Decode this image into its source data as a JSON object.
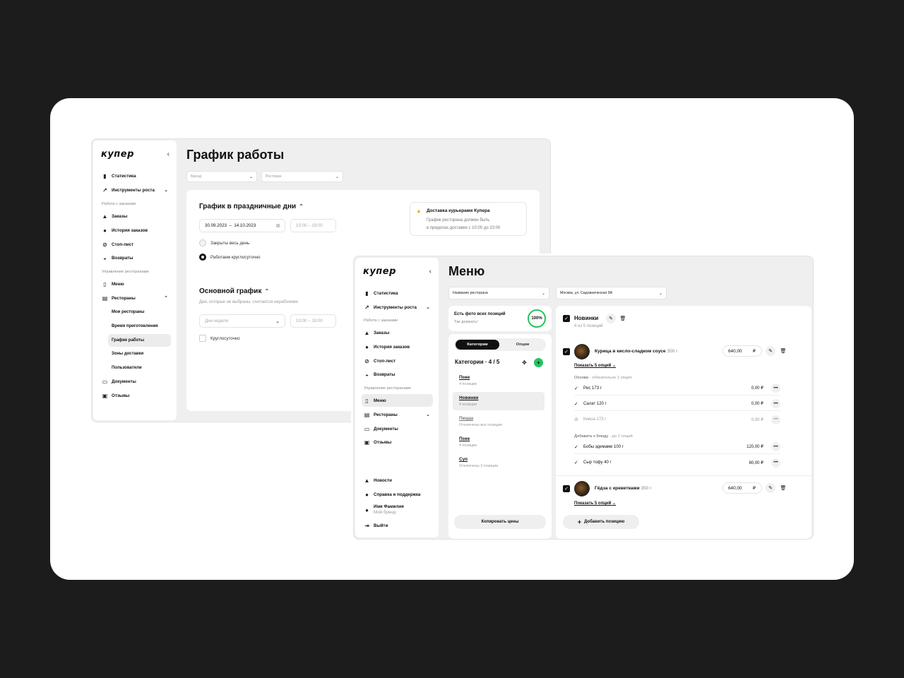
{
  "schedule_window": {
    "logo": "купер",
    "collapse_icon": "‹",
    "nav": [
      {
        "label": "Статистика",
        "icon": "chart-icon"
      },
      {
        "label": "Инструменты роста",
        "icon": "growth-icon"
      },
      {
        "section": "Работа с заказами"
      },
      {
        "label": "Заказы",
        "icon": "orders-icon"
      },
      {
        "label": "История заказов",
        "icon": "history-icon"
      },
      {
        "label": "Стоп-лист",
        "icon": "stop-icon"
      },
      {
        "label": "Возвраты",
        "icon": "returns-icon"
      },
      {
        "section": "Управление ресторанами"
      },
      {
        "label": "Меню",
        "icon": "menu-book-icon"
      },
      {
        "label": "Рестораны",
        "icon": "store-icon"
      }
    ],
    "sections": {
      "orders": "Работа с заказами",
      "restaurants": "Управление ресторанами"
    },
    "items": {
      "stats": "Статистика",
      "growth": "Инструменты роста",
      "orders": "Заказы",
      "history": "История заказов",
      "stoplist": "Стоп-лист",
      "returns": "Возвраты",
      "menu": "Меню",
      "restaurants": "Рестораны",
      "my_restaurants": "Мои рестораны",
      "cook_time": "Время приготовления",
      "schedule": "График работы",
      "zones": "Зоны доставки",
      "users": "Пользователи",
      "documents": "Документы",
      "reviews": "Отзывы"
    },
    "title": "График работы",
    "brand_select": "Бренд",
    "restaurant_select": "Ресторан",
    "holidays": {
      "title": "График в праздничные дни",
      "date_from": "30.09.2023",
      "date_sep": "–",
      "date_to": "14.10.2023",
      "time": "10:00 – 19:00",
      "closed_label": "Закрыты весь день",
      "allday_label": "Работаем круглосуточно"
    },
    "notice": {
      "title": "Доставка курьерами Купера",
      "line1": "График ресторана должен быть",
      "line2": "в пределах доставки с 10:00 до 23:00"
    },
    "main": {
      "title": "Основной график",
      "hint": "Дни, которые не выбраны, считаются нерабочими",
      "days_placeholder": "Дни недели",
      "time": "10:00 – 19:00",
      "allday_label": "Круглосуточно"
    }
  },
  "menu_window": {
    "logo": "купер",
    "items": {
      "stats": "Статистика",
      "growth": "Инструменты роста",
      "orders": "Заказы",
      "history": "История заказов",
      "stoplist": "Стоп-лист",
      "returns": "Возвраты",
      "menu": "Меню",
      "restaurants": "Рестораны",
      "documents": "Документы",
      "reviews": "Отзывы",
      "news": "Новости",
      "help": "Справка и поддержка",
      "user_name": "Имя Фамилия",
      "user_brand": "Мой бренд",
      "logout": "Выйти"
    },
    "sections": {
      "orders": "Работа с заказами",
      "restaurants": "Управление ресторанами"
    },
    "title": "Меню",
    "restaurant_select": "Название ресторана",
    "address_select": "Москва, ул. Садовническая 9А",
    "photo_card": {
      "title": "Есть фото всех позиций",
      "subtitle": "Так держать!",
      "percent": "100%"
    },
    "tabs": {
      "active": "Категории",
      "inactive": "Опции"
    },
    "categories_header": "Категории · 4 / 5",
    "categories": [
      {
        "name": "Поке",
        "count": "4 позиции"
      },
      {
        "name": "Новинки",
        "count": "4 позиции"
      },
      {
        "name": "Пицца",
        "count": "Отключены все позиции"
      },
      {
        "name": "Поке",
        "count": "4 позиции"
      },
      {
        "name": "Суп",
        "count": "Отключены 3 позиции"
      }
    ],
    "copy_prices": "Копировать цены",
    "group": {
      "title": "Новинки",
      "subtitle": "4 из 5 позиций"
    },
    "dish1": {
      "name": "Курица в кисло-сладком соусе",
      "weight": "350 г",
      "price": "640,00",
      "currency": "₽",
      "show_options": "Показать 5 опций",
      "base_header": "Основа",
      "base_note": "· обязательно 1 опция",
      "options": [
        {
          "name": "Рис 173 г",
          "price": "0,00 ₽",
          "state": "checked"
        },
        {
          "name": "Салат 120 г",
          "price": "0,00 ₽",
          "state": "checked"
        },
        {
          "name": "Киноа 173 г",
          "price": "0,00 ₽",
          "state": "disabled"
        }
      ],
      "extra_header": "Добавить к блюду",
      "extra_note": "· до 2 опций",
      "extras": [
        {
          "name": "Бобы эдемаме 100 г",
          "price": "120,00 ₽",
          "state": "checked"
        },
        {
          "name": "Сыр тофу 40 г",
          "price": "80,00 ₽",
          "state": "checked"
        }
      ]
    },
    "dish2": {
      "name": "Гёдза с креветками",
      "weight": "350 г",
      "price": "640,00",
      "currency": "₽",
      "show_options": "Показать 5 опций"
    },
    "add_position": "Добавить позицию"
  },
  "colors": {
    "accent_green": "#22c55e",
    "warning": "#f5a623",
    "dark": "#111111"
  }
}
